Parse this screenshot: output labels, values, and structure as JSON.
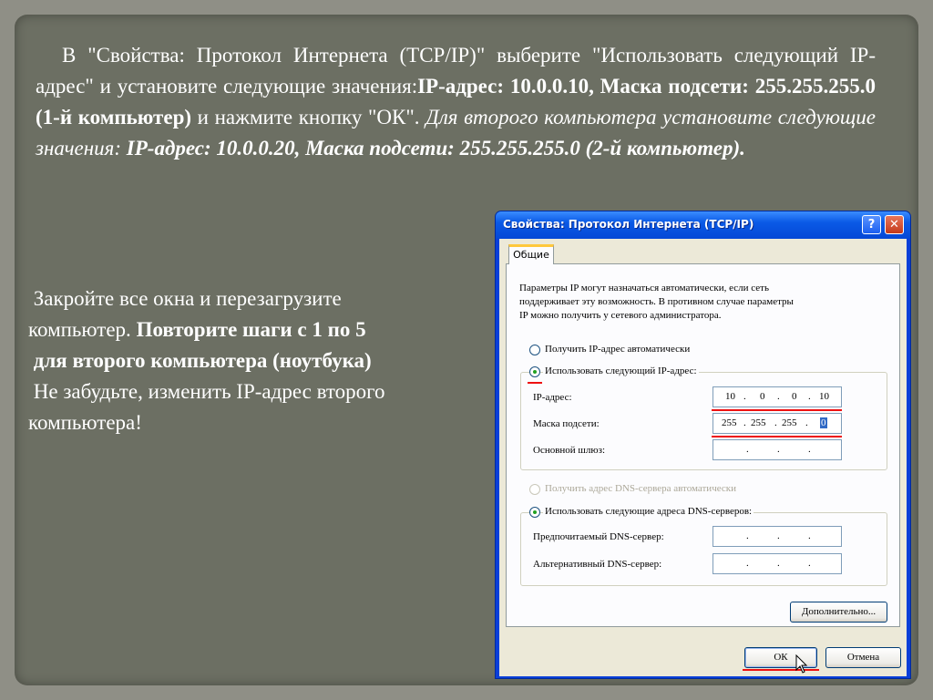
{
  "slide": {
    "para1": {
      "t1": "В \"Свойства: Протокол Интернета (TCP/IP)\" выберите \"Использовать следующий IP-адрес\" и установите следующие значения:",
      "t2": "IP-адрес: 10.0.0.10, Маска подсети: 255.255.255.0 (1-й компьютер)",
      "t3": " и нажмите кнопку \"ОК\". ",
      "t4": "Для второго компьютера установите следующие значения: ",
      "t5": "IP-адрес: 10.0.0.20, Маска подсети: 255.255.255.0 (2-й компьютер)."
    },
    "para2": {
      "line1": "Закройте все окна и перезагрузите",
      "line2a": "компьютер. ",
      "line2b": "Повторите шаги с 1 по 5",
      "line3": "для второго компьютера (ноутбука)",
      "line4": "Не забудьте, изменить IP-адрес второго",
      "line5": "компьютера!"
    }
  },
  "dialog": {
    "title": "Свойства: Протокол Интернета (TCP/IP)",
    "help_label": "?",
    "close_label": "✕",
    "tab_label": "Общие",
    "description": [
      "Параметры IP могут назначаться автоматически, если сеть",
      "поддерживает эту возможность. В противном случае параметры",
      "IP можно получить у сетевого администратора."
    ],
    "radio_auto_ip": "Получить IP-адрес автоматически",
    "radio_manual_ip": "Использовать следующий IP-адрес:",
    "ip_label": "IP-адрес:",
    "mask_label": "Маска подсети:",
    "gateway_label": "Основной шлюз:",
    "ip_octets": [
      "10",
      "0",
      "0",
      "10"
    ],
    "mask_octets": [
      "255",
      "255",
      "255",
      "0"
    ],
    "dot": ".",
    "radio_auto_dns": "Получить адрес DNS-сервера автоматически",
    "radio_manual_dns": "Использовать следующие адреса DNS-серверов:",
    "preferred_dns_label": "Предпочитаемый DNS-сервер:",
    "alternate_dns_label": "Альтернативный DNS-сервер:",
    "advanced_button": "Дополнительно...",
    "ok_button": "ОК",
    "cancel_button": "Отмена"
  },
  "colors": {
    "slide_bg": "#6c6f63",
    "title_blue": "#0a5ae6",
    "underline_red": "#e11"
  }
}
